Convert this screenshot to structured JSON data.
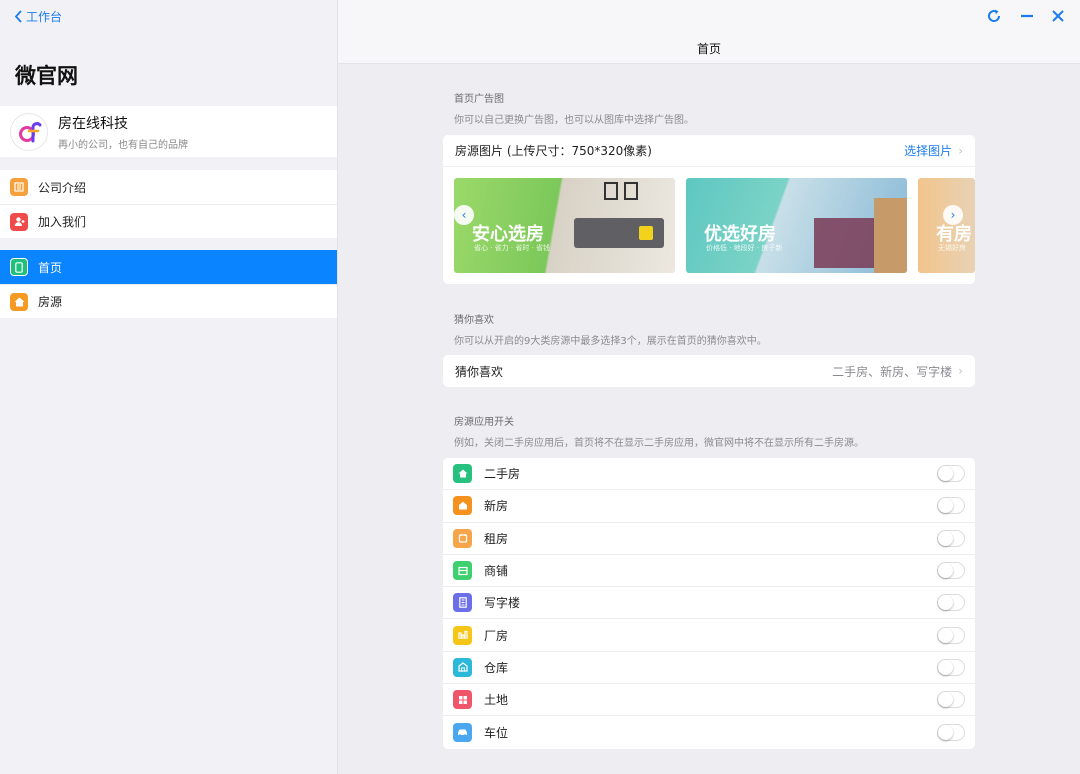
{
  "sidebar": {
    "back_label": "工作台",
    "app_title": "微官网",
    "company": {
      "name": "房在线科技",
      "slogan": "再小的公司，也有自己的品牌"
    },
    "group1": [
      {
        "label": "公司介绍",
        "icon": "building-icon",
        "color": "#f5a03a"
      },
      {
        "label": "加入我们",
        "icon": "add-user-icon",
        "color": "#f04a4a"
      }
    ],
    "group2": [
      {
        "label": "首页",
        "icon": "phone-icon",
        "color": "#1ec07b",
        "active": true
      },
      {
        "label": "房源",
        "icon": "home-icon",
        "color": "#f59a23"
      }
    ]
  },
  "header": {
    "title": "首页"
  },
  "ads": {
    "section_label": "首页广告图",
    "section_desc": "你可以自己更换广告图，也可以从图库中选择广告图。",
    "row_title": "房源图片 (上传尺寸：750*320像素)",
    "select_label": "选择图片",
    "banners": [
      {
        "title": "安心选房",
        "subtitle": "省心 · 省力 · 省时 · 省钱"
      },
      {
        "title": "优选好房",
        "subtitle": "价格低 · 地段好 · 房子新"
      },
      {
        "title": "有房",
        "subtitle": "无锡好房"
      }
    ]
  },
  "guess": {
    "section_label": "猜你喜欢",
    "section_desc": "你可以从开启的9大类房源中最多选择3个，展示在首页的猜你喜欢中。",
    "row_label": "猜你喜欢",
    "row_value": "二手房、新房、写字楼"
  },
  "switches": {
    "section_label": "房源应用开关",
    "section_desc": "例如，关闭二手房应用后，首页将不在显示二手房应用，微官网中将不在显示所有二手房源。",
    "items": [
      {
        "label": "二手房",
        "color": "#27c17f",
        "icon": "house-icon",
        "on": false
      },
      {
        "label": "新房",
        "color": "#f5921e",
        "icon": "new-house-icon",
        "on": false
      },
      {
        "label": "租房",
        "color": "#f7a54a",
        "icon": "rent-icon",
        "on": false
      },
      {
        "label": "商铺",
        "color": "#3ecf6e",
        "icon": "shop-icon",
        "on": false
      },
      {
        "label": "写字楼",
        "color": "#6b6fe8",
        "icon": "office-icon",
        "on": false
      },
      {
        "label": "厂房",
        "color": "#f5c518",
        "icon": "factory-icon",
        "on": false
      },
      {
        "label": "仓库",
        "color": "#2bb8d9",
        "icon": "warehouse-icon",
        "on": false
      },
      {
        "label": "土地",
        "color": "#f0566a",
        "icon": "land-icon",
        "on": false
      },
      {
        "label": "车位",
        "color": "#4aa7f0",
        "icon": "car-icon",
        "on": false
      }
    ]
  }
}
